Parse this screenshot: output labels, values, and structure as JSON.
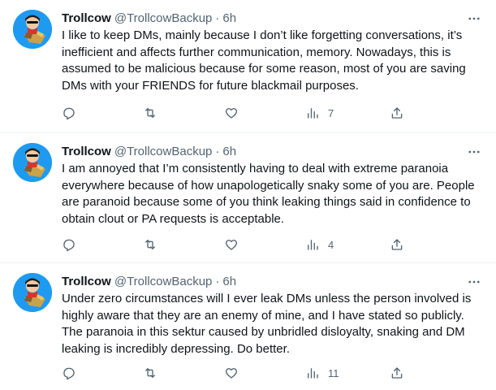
{
  "tweets": [
    {
      "display_name": "Trollcow",
      "handle": "@TrollcowBackup",
      "separator": "·",
      "time": "6h",
      "text": "I like to keep DMs, mainly because I don’t like forgetting conversations, it’s inefficient and affects further communication, memory. Nowadays, this is assumed to be malicious because for some reason, most of you are saving DMs with your FRIENDS for future blackmail purposes.",
      "views": "7"
    },
    {
      "display_name": "Trollcow",
      "handle": "@TrollcowBackup",
      "separator": "·",
      "time": "6h",
      "text": "I am annoyed that I’m consistently having to deal with extreme paranoia everywhere because of how unapologetically snaky some of you are. People are paranoid because some of you think leaking things said in confidence to obtain clout or PA requests is acceptable.",
      "views": "4"
    },
    {
      "display_name": "Trollcow",
      "handle": "@TrollcowBackup",
      "separator": "·",
      "time": "6h",
      "text": "Under zero circumstances will I ever leak DMs unless the person involved is highly aware that they are an enemy of mine, and I have stated so publicly. The paranoia in this sektur caused by unbridled disloyalty, snaking and DM leaking is incredibly depressing. Do better.",
      "views": "11"
    }
  ],
  "icons": {
    "more": "more-horizontal-icon",
    "reply": "reply-icon",
    "retweet": "retweet-icon",
    "like": "heart-icon",
    "views": "views-chart-icon",
    "share": "share-icon"
  },
  "colors": {
    "text": "#0f1419",
    "secondary": "#536471",
    "divider": "#eff3f4",
    "avatar_bg": "#1e9bf0"
  }
}
